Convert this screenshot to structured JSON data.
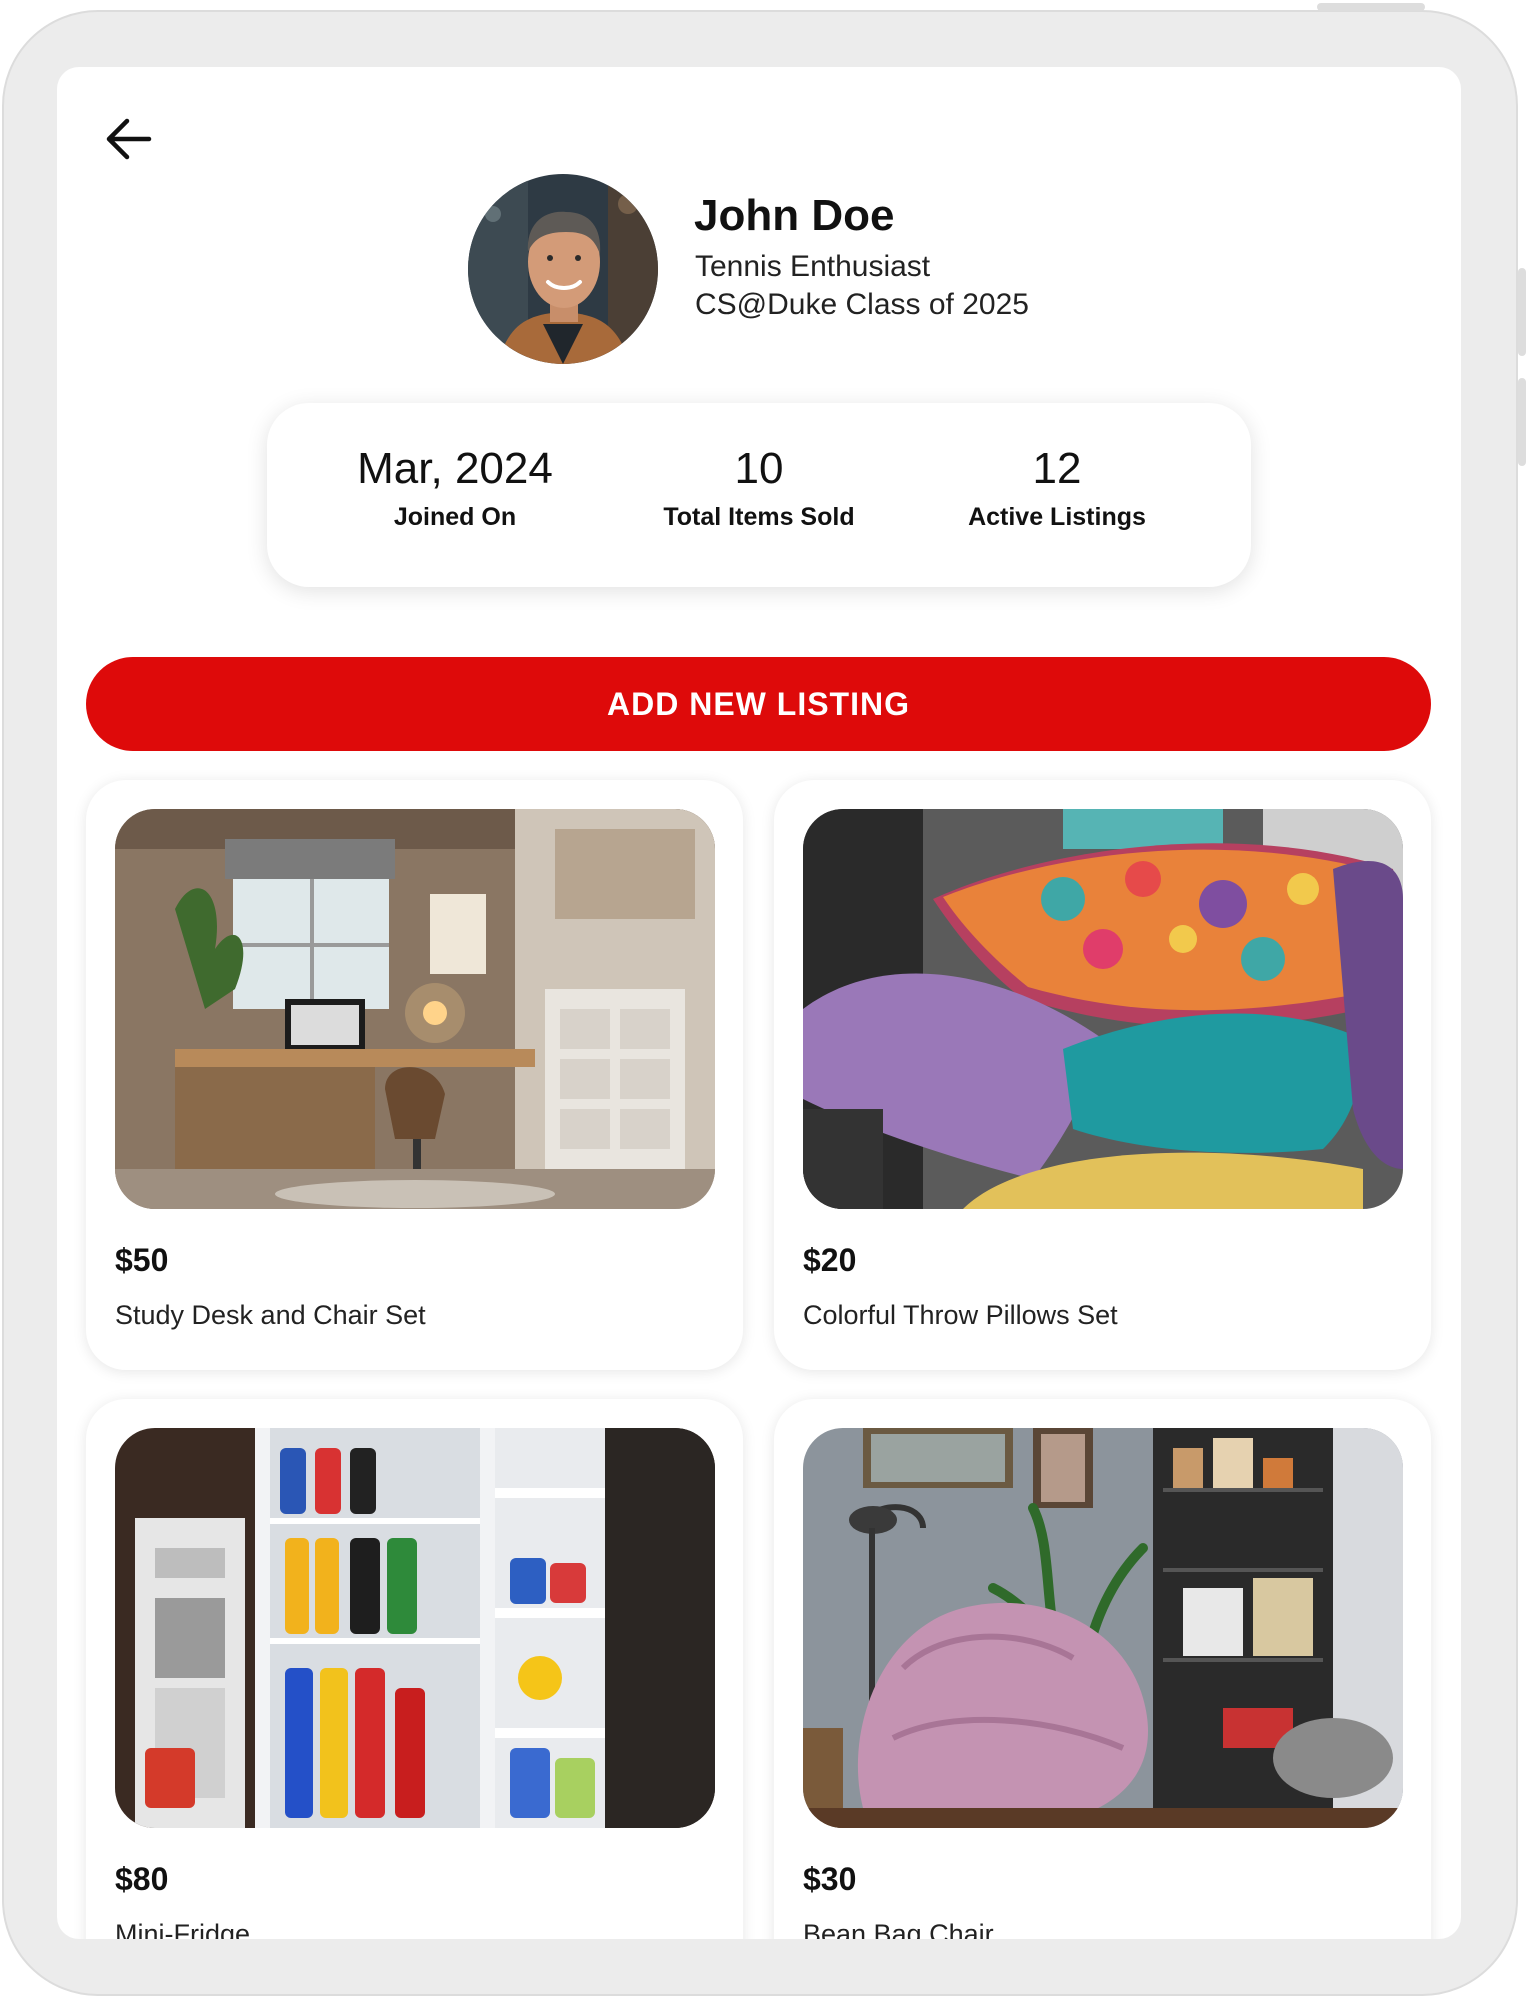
{
  "profile": {
    "name": "John Doe",
    "tagline": "Tennis Enthusiast",
    "school": "CS@Duke Class of 2025"
  },
  "stats": [
    {
      "value": "Mar, 2024",
      "label": "Joined On"
    },
    {
      "value": "10",
      "label": "Total Items Sold"
    },
    {
      "value": "12",
      "label": "Active Listings"
    }
  ],
  "actions": {
    "add_listing": "ADD NEW LISTING"
  },
  "listings": [
    {
      "price": "$50",
      "title": "Study Desk and Chair Set"
    },
    {
      "price": "$20",
      "title": "Colorful Throw Pillows Set"
    },
    {
      "price": "$80",
      "title": "Mini-Fridge"
    },
    {
      "price": "$30",
      "title": "Bean Bag Chair"
    }
  ],
  "colors": {
    "accent": "#de0a0a",
    "background": "#ffffff",
    "bezel": "#ececec"
  },
  "icons": {
    "back": "arrow-left-icon"
  }
}
